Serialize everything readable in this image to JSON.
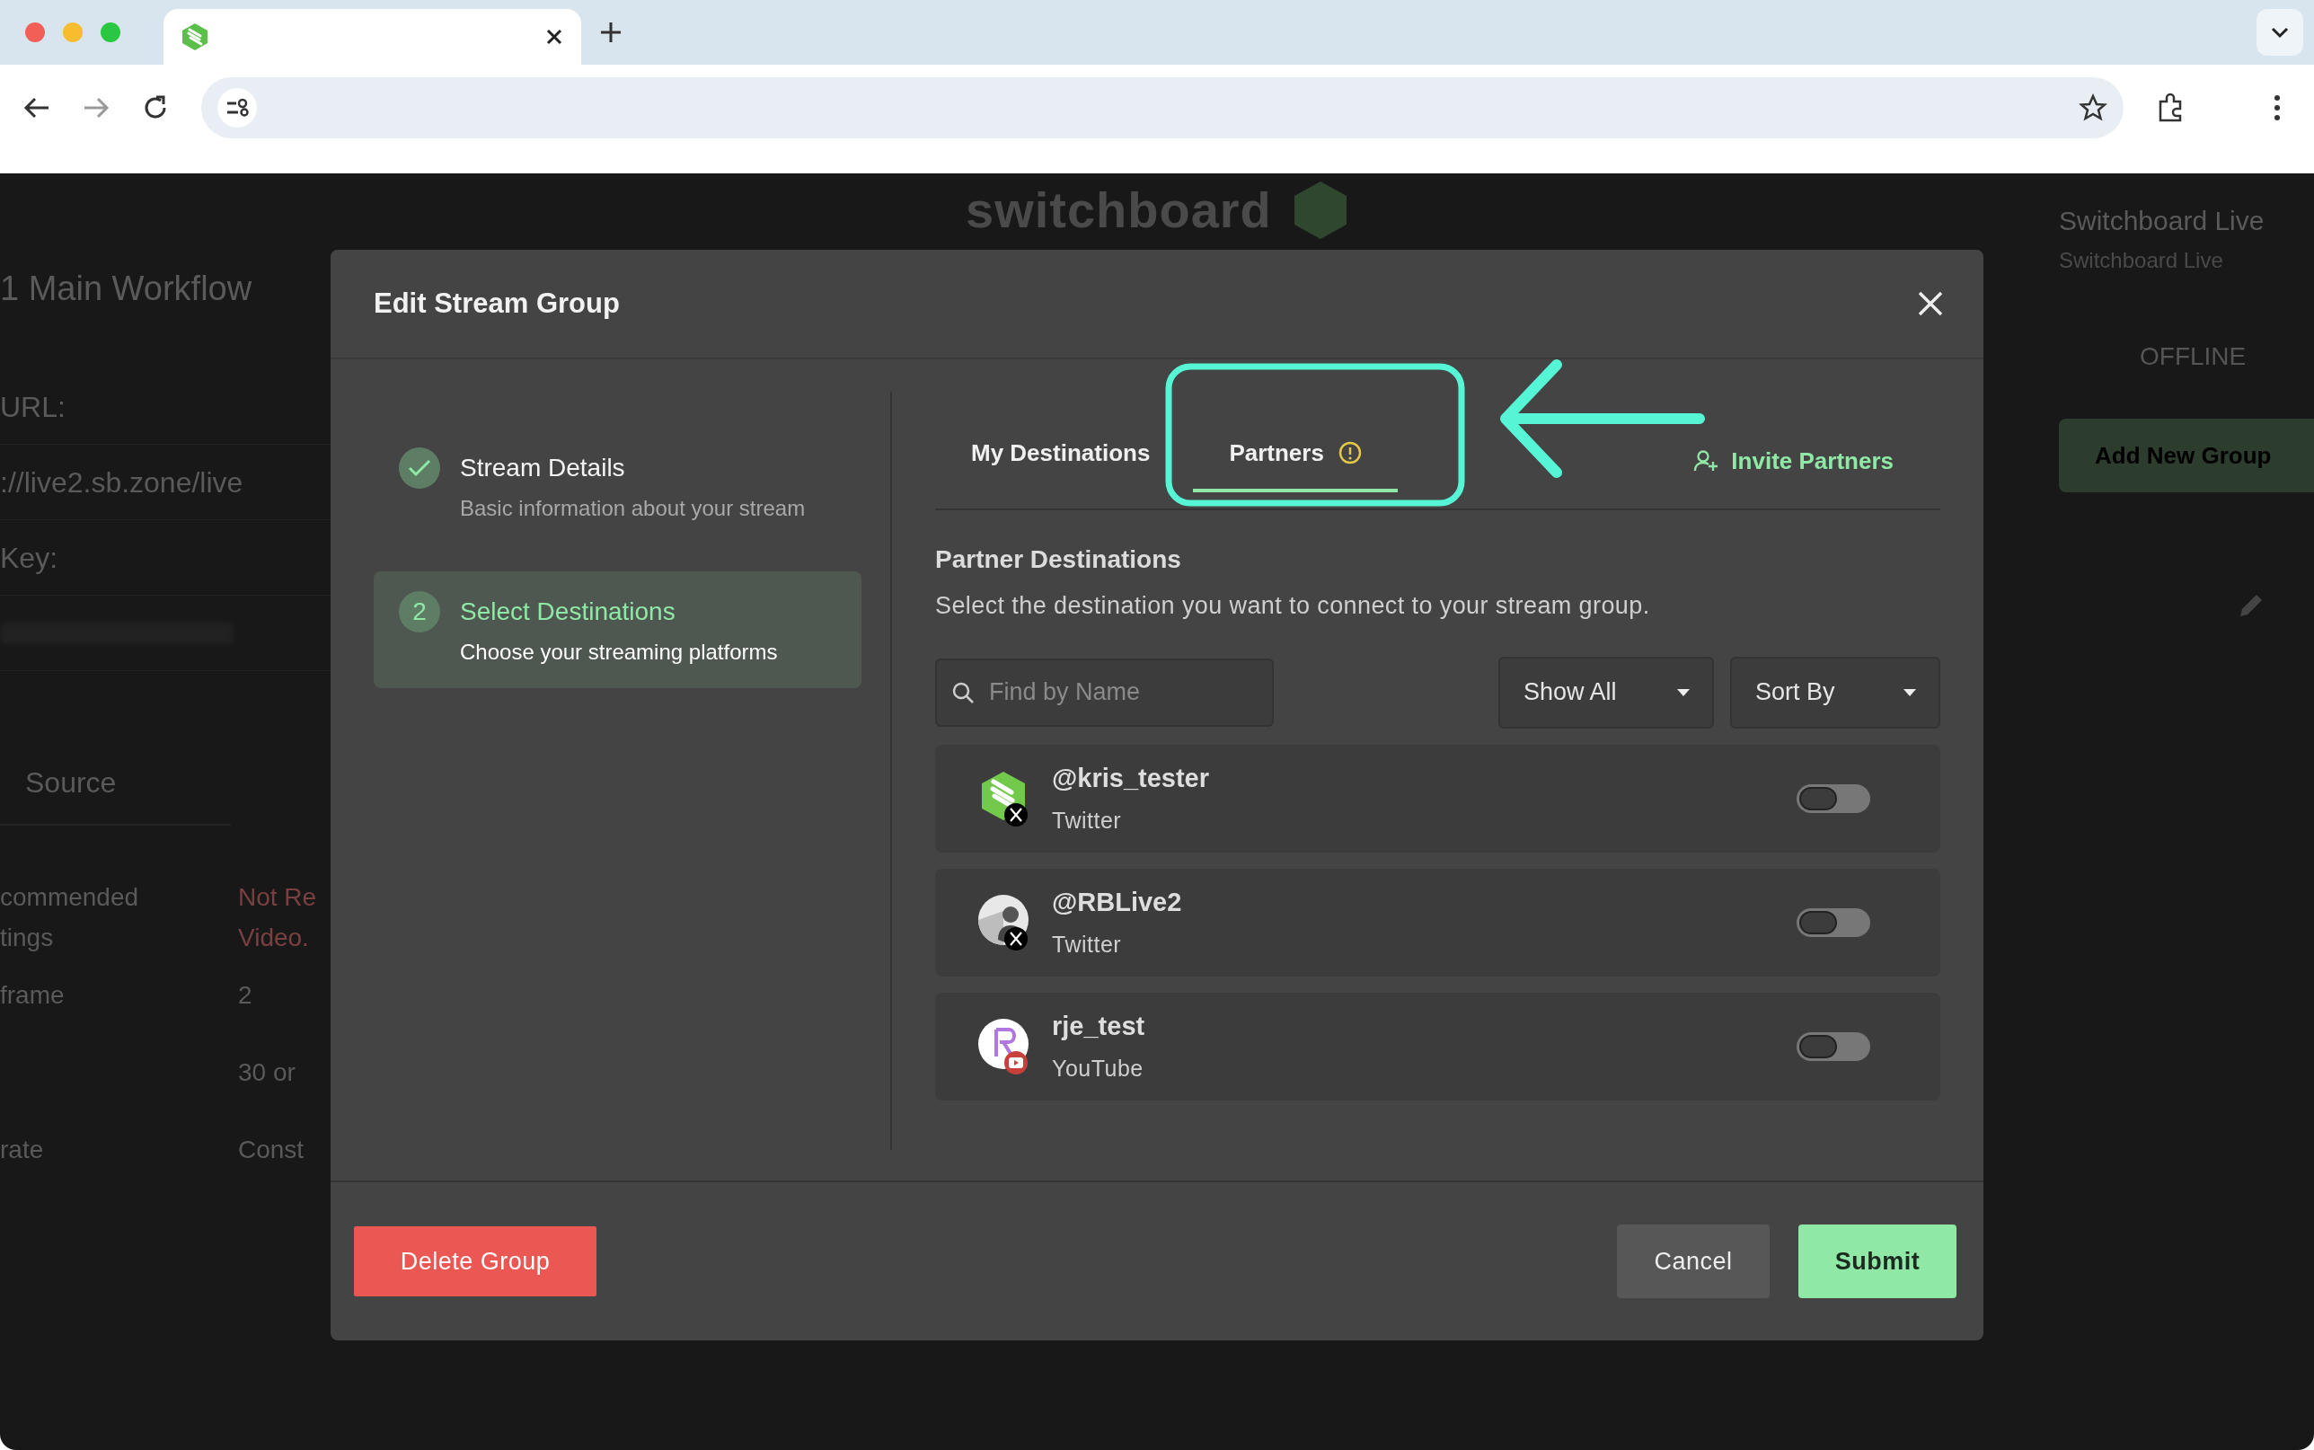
{
  "background": {
    "logo": "switchboard",
    "title": "1 Main Workflow",
    "fields": [
      {
        "kind": "label",
        "text": "URL:"
      },
      {
        "kind": "value",
        "text": "://live2.sb.zone/live"
      },
      {
        "kind": "label",
        "text": "Key:"
      },
      {
        "kind": "hidden"
      }
    ],
    "source_tab": "Source",
    "settings": [
      {
        "label": "commended\ntings",
        "value": "Not Re\nVideo.",
        "warn": true
      },
      {
        "label": "frame",
        "value": "2",
        "warn": false
      },
      {
        "value": "30 or",
        "warn": false
      },
      {
        "label": "rate",
        "value": "Const",
        "warn": false
      }
    ],
    "account_name": "Switchboard Live",
    "account_sub": "Switchboard Live",
    "status": "OFFLINE",
    "add_button": "Add New Group"
  },
  "modal": {
    "title": "Edit Stream Group",
    "steps": [
      {
        "kind": "done",
        "title": "Stream Details",
        "description": "Basic information about your stream",
        "selected": false
      },
      {
        "kind": "number",
        "number": "2",
        "title": "Select Destinations",
        "description": "Choose your streaming platforms",
        "selected": true
      }
    ],
    "tabs": [
      {
        "label": "My Destinations",
        "selected": false,
        "warning": false
      },
      {
        "label": "Partners",
        "selected": true,
        "warning": true
      }
    ],
    "invite_link": "Invite Partners",
    "section_title": "Partner Destinations",
    "section_description": "Select the destination you want to connect to your stream group.",
    "search": {
      "placeholder": "Find by Name"
    },
    "dropdowns": [
      "Show All",
      "Sort By"
    ],
    "destinations": [
      {
        "name": "@kris_tester",
        "platform": "Twitter",
        "kind": "logo",
        "badge": {
          "kind": "x",
          "color": "#000000"
        },
        "on": false
      },
      {
        "name": "@RBLive2",
        "platform": "Twitter",
        "kind": "photo",
        "badge": {
          "kind": "x",
          "color": "#000000"
        },
        "on": false
      },
      {
        "name": "rje_test",
        "platform": "YouTube",
        "kind": "letter",
        "badge": {
          "kind": "youtube",
          "color": "#c8403c"
        },
        "on": false
      }
    ],
    "buttons": {
      "delete": "Delete Group",
      "cancel": "Cancel",
      "submit": "Submit"
    }
  }
}
